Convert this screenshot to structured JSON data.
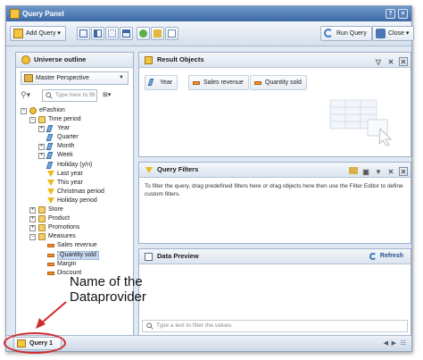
{
  "window": {
    "title": "Query Panel"
  },
  "toolbar": {
    "add_query": "Add Query",
    "run_query": "Run Query",
    "close": "Close"
  },
  "universe_panel": {
    "title": "Universe outline",
    "perspective": "Master Perspective",
    "filter_placeholder": "Type here to filt",
    "tree": [
      {
        "label": "eFashion",
        "type": "universe",
        "level": 0,
        "expander": "-"
      },
      {
        "label": "Time period",
        "type": "folder",
        "level": 1,
        "expander": "-"
      },
      {
        "label": "Year",
        "type": "dimension",
        "level": 2,
        "expander": "+"
      },
      {
        "label": "Quarter",
        "type": "dimension",
        "level": 2,
        "expander": ""
      },
      {
        "label": "Month",
        "type": "dimension",
        "level": 2,
        "expander": "+"
      },
      {
        "label": "Week",
        "type": "dimension",
        "level": 2,
        "expander": "+"
      },
      {
        "label": "Holiday (y/n)",
        "type": "dimension",
        "level": 2,
        "expander": ""
      },
      {
        "label": "Last year",
        "type": "filter",
        "level": 2,
        "expander": ""
      },
      {
        "label": "This year",
        "type": "filter",
        "level": 2,
        "expander": ""
      },
      {
        "label": "Christmas period",
        "type": "filter",
        "level": 2,
        "expander": ""
      },
      {
        "label": "Holiday period",
        "type": "filter",
        "level": 2,
        "expander": ""
      },
      {
        "label": "Store",
        "type": "folder",
        "level": 1,
        "expander": "+"
      },
      {
        "label": "Product",
        "type": "folder",
        "level": 1,
        "expander": "+"
      },
      {
        "label": "Promotions",
        "type": "folder",
        "level": 1,
        "expander": "+"
      },
      {
        "label": "Measures",
        "type": "folder",
        "level": 1,
        "expander": "-"
      },
      {
        "label": "Sales revenue",
        "type": "measure",
        "level": 2,
        "expander": ""
      },
      {
        "label": "Quantity sold",
        "type": "measure",
        "level": 2,
        "expander": "",
        "selected": true
      },
      {
        "label": "Margin",
        "type": "measure",
        "level": 2,
        "expander": ""
      },
      {
        "label": "Discount",
        "type": "measure",
        "level": 2,
        "expander": ""
      }
    ]
  },
  "result_objects": {
    "title": "Result Objects",
    "items": [
      {
        "label": "Year",
        "type": "dimension"
      },
      {
        "label": "Sales revenue",
        "type": "measure"
      },
      {
        "label": "Quantity sold",
        "type": "measure"
      }
    ]
  },
  "query_filters": {
    "title": "Query Filters",
    "help_text": "To filter the query, drag predefined filters here or drag objects here then use the Filter Editor to define custom filters."
  },
  "data_preview": {
    "title": "Data Preview",
    "refresh": "Refresh",
    "search_placeholder": "Type a text to filter the values"
  },
  "bottom_bar": {
    "query_tab": "Query 1"
  },
  "annotation": {
    "line1": "Name of the",
    "line2": "Dataprovider"
  },
  "colors": {
    "accent": "#3d6aa6",
    "annotation_red": "#d12b2b"
  }
}
